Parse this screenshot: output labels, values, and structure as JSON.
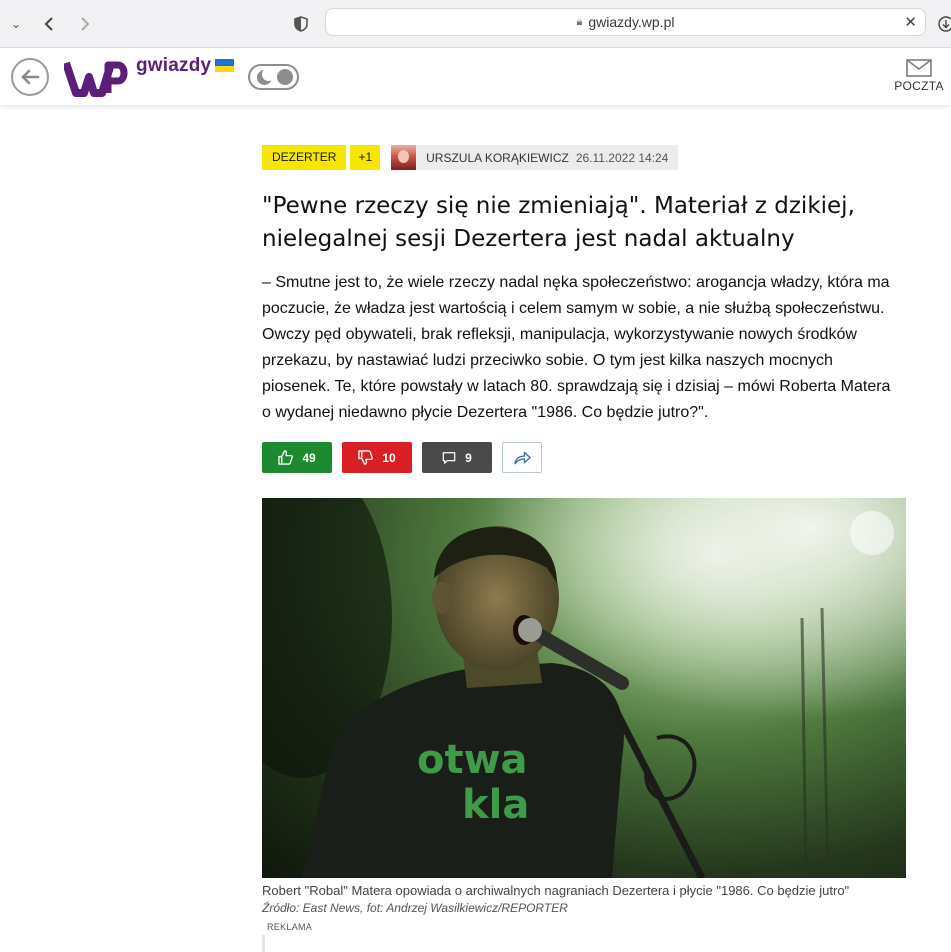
{
  "browser": {
    "url": "gwiazdy.wp.pl",
    "close_glyph": "✕"
  },
  "header": {
    "brand": "gwiazdy",
    "mail_label": "POCZTA"
  },
  "article": {
    "tags": [
      "DEZERTER",
      "+1"
    ],
    "author": "URSZULA KORĄKIEWICZ",
    "date": "26.11.2022 14:24",
    "title": "\"Pewne rzeczy się nie zmieniają\". Materiał z dzikiej, nielegalnej sesji Dezertera jest nadal aktualny",
    "lead": "– Smutne jest to, że wiele rzeczy nadal nęka społeczeństwo: arogancja władzy, która ma poczucie, że władza jest wartością i celem samym w sobie, a nie służbą społeczeństwu. Owczy pęd obywateli, brak refleksji, manipulacja, wykorzystywanie nowych środków przekazu, by nastawiać ludzi przeciwko sobie. O tym jest kilka naszych mocnych piosenek. Te, które powstały w latach 80. sprawdzają się i dzisiaj – mówi Roberta Matera o wydanej niedawno płycie Dezertera \"1986. Co będzie jutro?\".",
    "reactions": {
      "likes": "49",
      "dislikes": "10",
      "comments": "9"
    },
    "photo_caption": "Robert \"Robal\" Matera opowiada o archiwalnych nagraniach Dezertera i płycie \"1986. Co będzie jutro\"",
    "photo_credit": "Źródło: East News, fot: Andrzej Wasilkiewicz/REPORTER",
    "ad_label": "REKLAMA"
  },
  "colors": {
    "tag_yellow": "#f7e600",
    "like_green": "#1e8a30",
    "dislike_red": "#d91f23",
    "comment_gray": "#4a4a4a",
    "brand_purple": "#5b1f7a"
  },
  "icons": [
    "chevron-down-icon",
    "back-arrow-icon",
    "forward-arrow-icon",
    "shield-icon",
    "lock-icon",
    "download-icon",
    "back-circle-icon",
    "theme-toggle-icon",
    "mail-icon",
    "thumb-up-icon",
    "thumb-down-icon",
    "comment-icon",
    "share-icon"
  ]
}
